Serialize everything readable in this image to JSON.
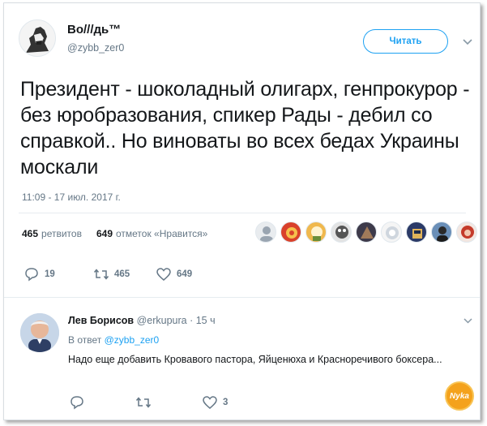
{
  "tweet": {
    "author_name": "Во///дь™",
    "author_handle": "@zybb_zer0",
    "follow_label": "Читать",
    "text": "Президент - шоколадный олигарх, генпрокурор - без юробразования, спикер Рады - дебил со справкой.. Но виноваты во всех бедах Украины москали",
    "timestamp": "11:09 - 17 июл. 2017 г.",
    "retweets_count": "465",
    "retweets_label": "ретвитов",
    "likes_count": "649",
    "likes_label": "отметок «Нравится»",
    "actions": {
      "reply_count": "19",
      "retweet_count": "465",
      "like_count": "649"
    }
  },
  "reply": {
    "author_name": "Лев Борисов",
    "author_handle": "@erkupura",
    "time": "· 15 ч",
    "in_reply_prefix": "В ответ",
    "in_reply_handle": "@zybb_zer0",
    "text": "Надо еще добавить Кровавого пастора, Яйценюха и Красноречивого боксера...",
    "actions": {
      "like_count": "3"
    }
  },
  "watermark_text": "Nyka",
  "colors": {
    "accent": "#1da1f2",
    "muted": "#657786",
    "text": "#14171a",
    "watermark": "#f4a21c"
  },
  "likers": [
    "avatar-1",
    "avatar-2",
    "avatar-3",
    "avatar-4",
    "avatar-5",
    "avatar-6",
    "avatar-7",
    "avatar-8",
    "avatar-9",
    "avatar-10"
  ]
}
